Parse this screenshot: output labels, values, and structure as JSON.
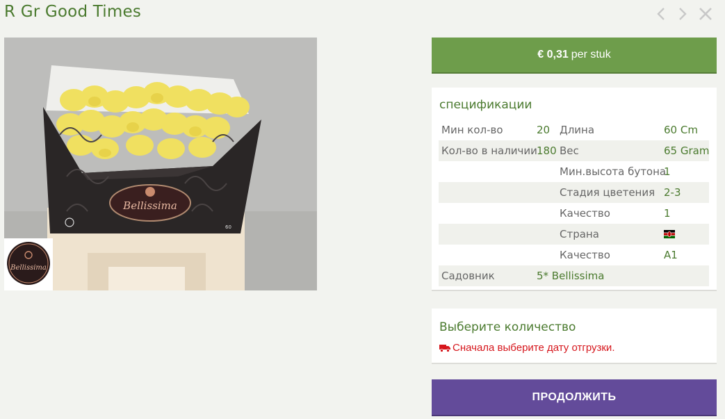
{
  "header": {
    "title": "R Gr Good Times",
    "icons": [
      "chevron-left-icon",
      "chevron-right-icon",
      "close-icon"
    ]
  },
  "product_image": {
    "brand_logo_text": "Bellissima",
    "box_count": "60"
  },
  "price": {
    "amount": "€ 0,31",
    "unit": "per stuk"
  },
  "specs": {
    "title": "спецификации",
    "rows": [
      {
        "label1": "Мин кол-во",
        "value1": "20",
        "label2": "Длина",
        "value2": "60 Cm"
      },
      {
        "label1": "Кол-во в наличии",
        "value1": "180",
        "label2": "Вес",
        "value2": "65 Gram"
      },
      {
        "label1": "",
        "value1": "",
        "label2": "Мин.высота бутона",
        "value2": "1"
      },
      {
        "label1": "",
        "value1": "",
        "label2": "Стадия цветения",
        "value2": "2-3"
      },
      {
        "label1": "",
        "value1": "",
        "label2": "Качество",
        "value2": "1"
      },
      {
        "label1": "",
        "value1": "",
        "label2": "Страна",
        "value2": ""
      },
      {
        "label1": "",
        "value1": "",
        "label2": "Качество",
        "value2": "A1"
      },
      {
        "label1": "Садовник",
        "value1": "5* Bellissima",
        "label2": "",
        "value2": ""
      }
    ],
    "country_flag_icon": "kenya-flag-icon"
  },
  "quantity": {
    "title": "Выберите количество",
    "warning": "Сначала выберите дату отгрузки.",
    "warning_icon": "truck-icon",
    "warning_color": "#d6161c"
  },
  "actions": {
    "continue_label": "ПРОДОЛЖИТЬ"
  },
  "colors": {
    "accent_green": "#6e9d4b",
    "title_green": "#4a7a2e",
    "continue_purple": "#634b9a"
  }
}
